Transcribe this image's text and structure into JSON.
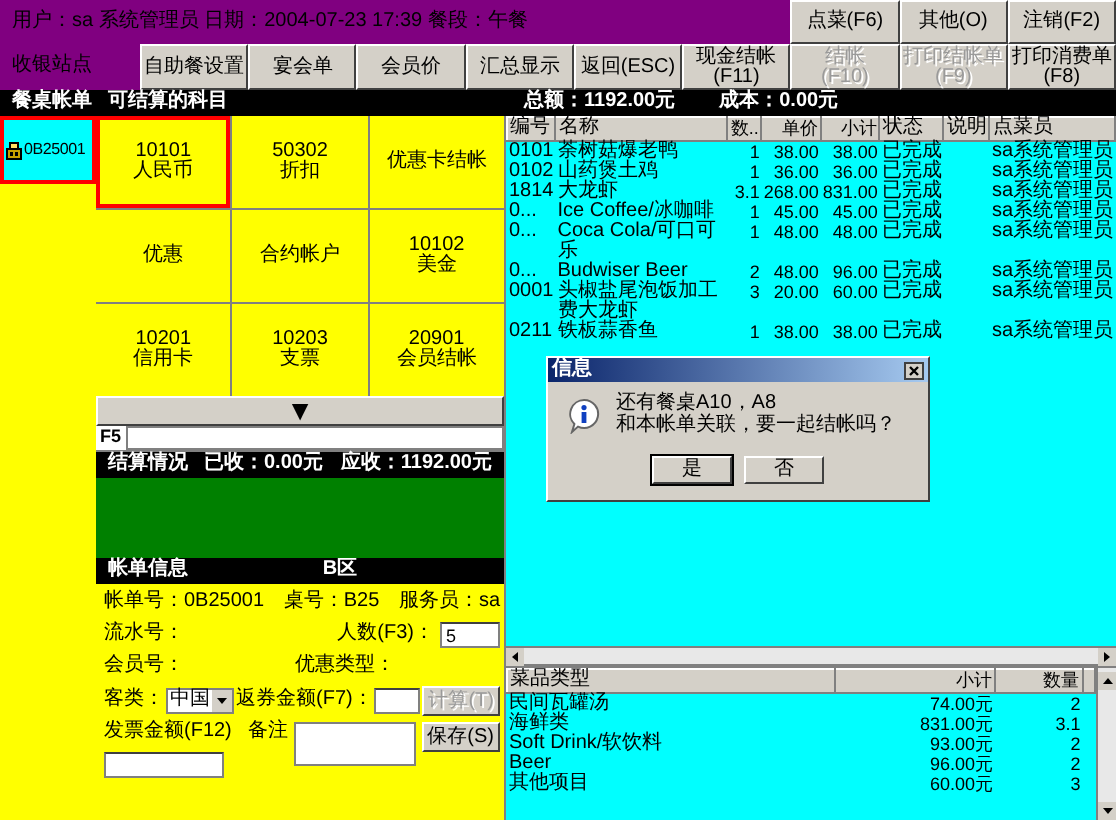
{
  "header": {
    "info": "用户：sa 系统管理员 日期：2004-07-23 17:39 餐段：午餐",
    "station": "收银站点"
  },
  "toolbar_top": [
    {
      "label": "点菜(F6)",
      "disabled": false
    },
    {
      "label": "其他(O)",
      "disabled": false
    },
    {
      "label": "注销(F2)",
      "disabled": false
    }
  ],
  "toolbar_bottom": [
    {
      "label": "自助餐设置",
      "disabled": false
    },
    {
      "label": "宴会单",
      "disabled": false
    },
    {
      "label": "会员价",
      "disabled": false
    },
    {
      "label": "汇总显示",
      "disabled": false
    },
    {
      "label": "返回(ESC)",
      "disabled": false
    },
    {
      "label": "现金结帐\n(F11)",
      "disabled": false
    },
    {
      "label": "结帐\n(F10)",
      "disabled": true
    },
    {
      "label": "打印结帐单\n(F9)",
      "disabled": true
    },
    {
      "label": "打印消费单\n(F8)",
      "disabled": false
    }
  ],
  "section_bar": {
    "bills_title": "餐桌帐单",
    "items_title": "可结算的科目",
    "total": "总额：1192.00元",
    "cost": "成本：0.00元"
  },
  "bills": [
    {
      "label": "0B25001",
      "selected": true
    }
  ],
  "payment_items": [
    {
      "code": "10101",
      "name": "人民币",
      "selected": true
    },
    {
      "code": "50302",
      "name": "折扣",
      "selected": false
    },
    {
      "name": "优惠卡结帐",
      "selected": false
    },
    {
      "name": "优惠",
      "selected": false
    },
    {
      "name": "合约帐户",
      "selected": false
    },
    {
      "code": "10102",
      "name": "美金",
      "selected": false
    },
    {
      "code": "10201",
      "name": "信用卡",
      "selected": false
    },
    {
      "code": "10203",
      "name": "支票",
      "selected": false
    },
    {
      "code": "20901",
      "name": "会员结帐",
      "selected": false
    }
  ],
  "page_down": "▼",
  "f5_label": "F5",
  "settlement": {
    "title": "结算情况",
    "received": "已收：0.00元",
    "due": "应收：1192.00元"
  },
  "bill_info": {
    "title": "帐单信息",
    "area": "B区",
    "bill_no": "帐单号：0B25001",
    "table": "桌号：B25",
    "waiter": "服务员：sa",
    "serial": "流水号：",
    "guests_label": "人数(F3)：",
    "guests": "5",
    "member": "会员号：",
    "discount_type": "优惠类型：",
    "guest_type_label": "客类：",
    "guest_type": "中国",
    "voucher_label": "返券金额(F7)：",
    "calc_button": {
      "label": "计算(T)",
      "disabled": true
    },
    "invoice_label": "发票金额(F12)",
    "note_label": "备注",
    "save_button": {
      "label": "保存(S)",
      "disabled": false
    }
  },
  "orders": {
    "columns": [
      "编号",
      "名称",
      "数..",
      "单价",
      "小计",
      "状态",
      "说明",
      "点菜员"
    ],
    "rows": [
      {
        "code": "0101",
        "name": "荼树菇爆老鸭",
        "qty": "1",
        "price": "38.00",
        "subtotal": "38.00",
        "status": "已完成",
        "staff": "sa系统管理员"
      },
      {
        "code": "0102",
        "name": "山药煲土鸡",
        "qty": "1",
        "price": "36.00",
        "subtotal": "36.00",
        "status": "已完成",
        "staff": "sa系统管理员"
      },
      {
        "code": "1814",
        "name": "大龙虾",
        "qty": "3.1",
        "price": "268.00",
        "subtotal": "831.00",
        "status": "已完成",
        "staff": "sa系统管理员"
      },
      {
        "code": "0...",
        "name": "Ice Coffee/冰咖啡",
        "qty": "1",
        "price": "45.00",
        "subtotal": "45.00",
        "status": "已完成",
        "staff": "sa系统管理员"
      },
      {
        "code": "0...",
        "name": "Coca Cola/可口可乐",
        "qty": "1",
        "price": "48.00",
        "subtotal": "48.00",
        "status": "已完成",
        "staff": "sa系统管理员"
      },
      {
        "code": "0...",
        "name": "Budwiser Beer",
        "qty": "2",
        "price": "48.00",
        "subtotal": "96.00",
        "status": "已完成",
        "staff": "sa系统管理员"
      },
      {
        "code": "0001",
        "name": "头椒盐尾泡饭加工费大龙虾",
        "qty": "3",
        "price": "20.00",
        "subtotal": "60.00",
        "status": "已完成",
        "staff": "sa系统管理员"
      },
      {
        "code": "0211",
        "name": "铁板蒜香鱼",
        "qty": "1",
        "price": "38.00",
        "subtotal": "38.00",
        "status": "已完成",
        "staff": "sa系统管理员"
      }
    ]
  },
  "categories": {
    "columns": [
      "菜品类型",
      "小计",
      "数量"
    ],
    "rows": [
      {
        "type": "民间瓦罐汤",
        "subtotal": "74.00元",
        "qty": "2"
      },
      {
        "type": "海鲜类",
        "subtotal": "831.00元",
        "qty": "3.1"
      },
      {
        "type": "Soft Drink/软饮料",
        "subtotal": "93.00元",
        "qty": "2"
      },
      {
        "type": "Beer",
        "subtotal": "96.00元",
        "qty": "2"
      },
      {
        "type": "其他项目",
        "subtotal": "60.00元",
        "qty": "3"
      }
    ]
  },
  "dialog": {
    "title": "信息",
    "message": [
      "还有餐桌A10，A8",
      "和本帐单关联，要一起结帐吗？"
    ],
    "buttons": [
      {
        "label": "是",
        "focused": true
      },
      {
        "label": "否",
        "focused": false
      }
    ]
  }
}
